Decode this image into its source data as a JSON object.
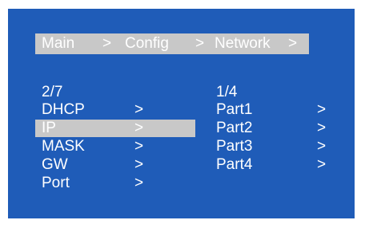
{
  "breadcrumb": {
    "items": [
      "Main",
      ">",
      "Config",
      ">",
      "Network",
      ">"
    ]
  },
  "left_menu": {
    "counter": "2/7",
    "items": [
      {
        "label": "DHCP",
        "arrow": ">",
        "selected": false
      },
      {
        "label": "IP",
        "arrow": ">",
        "selected": true
      },
      {
        "label": "MASK",
        "arrow": ">",
        "selected": false
      },
      {
        "label": "GW",
        "arrow": ">",
        "selected": false
      },
      {
        "label": "Port",
        "arrow": ">",
        "selected": false
      }
    ]
  },
  "right_menu": {
    "counter": "1/4",
    "items": [
      {
        "label": "Part1",
        "arrow": ">"
      },
      {
        "label": "Part2",
        "arrow": ">"
      },
      {
        "label": "Part3",
        "arrow": ">"
      },
      {
        "label": "Part4",
        "arrow": ">"
      }
    ]
  },
  "colors": {
    "background": "#1f5cb8",
    "highlight": "#c8c8c8",
    "text": "#ffffff"
  }
}
